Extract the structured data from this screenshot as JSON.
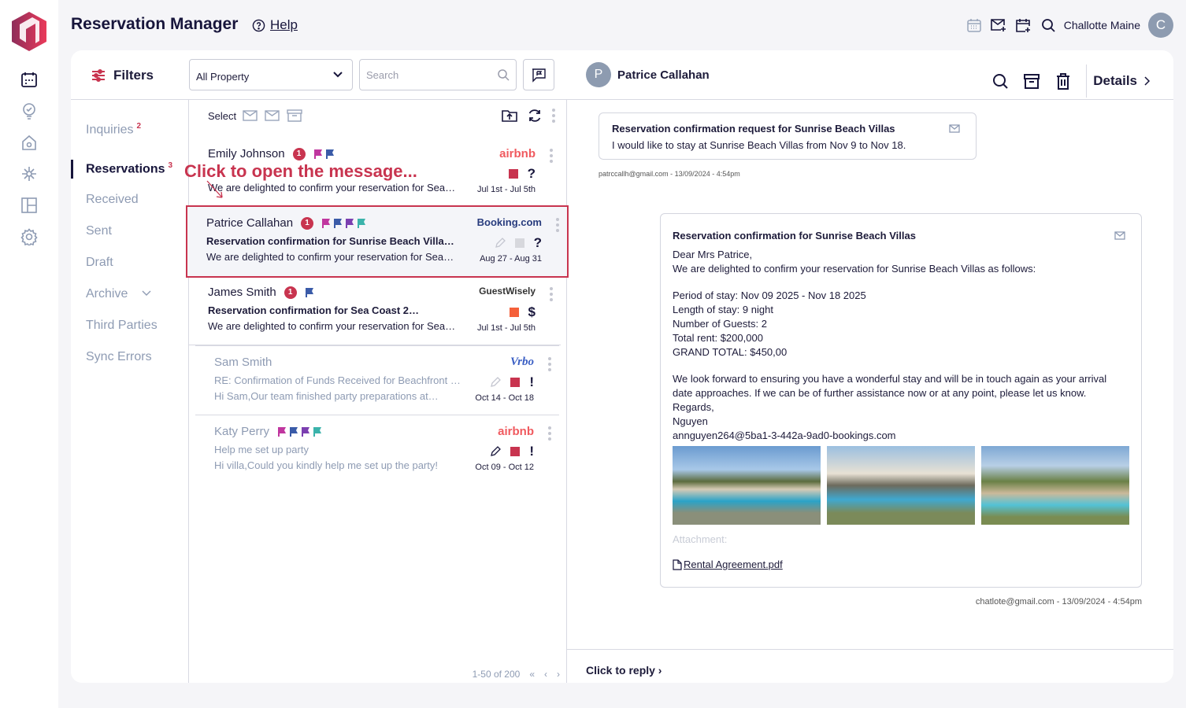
{
  "app": {
    "title": "Reservation Manager",
    "help": "Help",
    "user": "Challotte Maine",
    "user_initial": "C"
  },
  "rail": {
    "icons": [
      "calendar-icon",
      "lightbulb-check-icon",
      "home-gear-icon",
      "network-icon",
      "layout-icon",
      "settings-icon"
    ]
  },
  "toolbar": {
    "filters": "Filters",
    "property": "All Property",
    "search_placeholder": "Search"
  },
  "nav": {
    "items": [
      {
        "label": "Inquiries",
        "count": "2"
      },
      {
        "label": "Reservations",
        "count": "3"
      },
      {
        "label": "Received"
      },
      {
        "label": "Sent"
      },
      {
        "label": "Draft"
      },
      {
        "label": "Archive"
      },
      {
        "label": "Third Parties"
      },
      {
        "label": "Sync Errors"
      }
    ]
  },
  "list": {
    "select": "Select",
    "hint": "Click to open the message...",
    "messages": [
      {
        "name": "Emily Johnson",
        "badge": "1",
        "flags": [
          "#c0369f",
          "#3a5ba8"
        ],
        "subject": "",
        "preview": "We are delighted to confirm your reservation for Sea…",
        "source": "airbnb",
        "status_color": "#c8344f",
        "status_symbol": "?",
        "dates": "Jul 1st - Jul 5th"
      },
      {
        "name": "Patrice Callahan",
        "badge": "1",
        "flags": [
          "#c0369f",
          "#3a5ba8",
          "#7b3fb0",
          "#3bb3ab"
        ],
        "subject": "Reservation confirmation for Sunrise Beach Villas…",
        "preview": "We are delighted to confirm your reservation for Sea…",
        "source": "Booking.com",
        "status_color": "#d7d8dd",
        "status_symbol": "?",
        "dates": "Aug 27 - Aug 31"
      },
      {
        "name": "James Smith",
        "badge": "1",
        "flags": [
          "#3a5ba8"
        ],
        "subject": "Reservation confirmation for Sea Coast 2…",
        "preview": "We are delighted to confirm your reservation for Sea…",
        "source": "GuestWisely",
        "status_color": "#f5603a",
        "status_symbol": "$",
        "dates": "Jul 1st - Jul 5th"
      },
      {
        "name": "Sam Smith",
        "flags": [],
        "subject": "RE: Confirmation of Funds Received for Beachfront Villa…",
        "preview": "Hi Sam,Our team finished party preparations at…",
        "source": "Vrbo",
        "status_color": "#c8344f",
        "status_symbol": "!",
        "dates": "Oct 14 - Oct 18"
      },
      {
        "name": "Katy Perry",
        "flags": [
          "#c0369f",
          "#3a5ba8",
          "#7b3fb0",
          "#3bb3ab"
        ],
        "subject": "Help me set up party",
        "preview": "Hi villa,Could you kindly help me set up the party!",
        "source": "airbnb",
        "status_color": "#c8344f",
        "status_symbol": "!",
        "dates": "Oct 09 - Oct 12"
      }
    ],
    "pagination": "1-50 of 200"
  },
  "detail": {
    "name": "Patrice Callahan",
    "initial": "P",
    "details": "Details",
    "request": {
      "title": "Reservation confirmation request for Sunrise Beach Villas",
      "text": "I would like to stay at Sunrise Beach Villas from Nov 9 to Nov 18.",
      "meta": "patrccallh@gmail.com  - 13/09/2024 - 4:54pm"
    },
    "reply": {
      "title": "Reservation confirmation for Sunrise Beach Villas",
      "lines": [
        "Dear Mrs Patrice,",
        "We are delighted to confirm your reservation for Sunrise Beach Villas as follows:",
        "",
        "Period of stay: Nov 09 2025 - Nov 18 2025",
        "Length of stay: 9 night",
        "Number of Guests: 2",
        "Total rent: $200,000",
        "GRAND TOTAL: $450,00",
        "",
        "We look forward to ensuring you have a wonderful stay and will be in touch again as your arrival date approaches. If we can be of further assistance now or at any point, please let us know.",
        "Regards,",
        "Nguyen",
        "annguyen264@5ba1-3-442a-9ad0-bookings.com"
      ],
      "attachment_label": "Attachment:",
      "attachment": "Rental Agreement.pdf",
      "meta": "chatlote@gmail.com - 13/09/2024 - 4:54pm"
    },
    "click_reply": "Click to reply"
  },
  "colors": {
    "accent": "#c8344f",
    "dark": "#17153b",
    "muted": "#8e9bb3"
  }
}
